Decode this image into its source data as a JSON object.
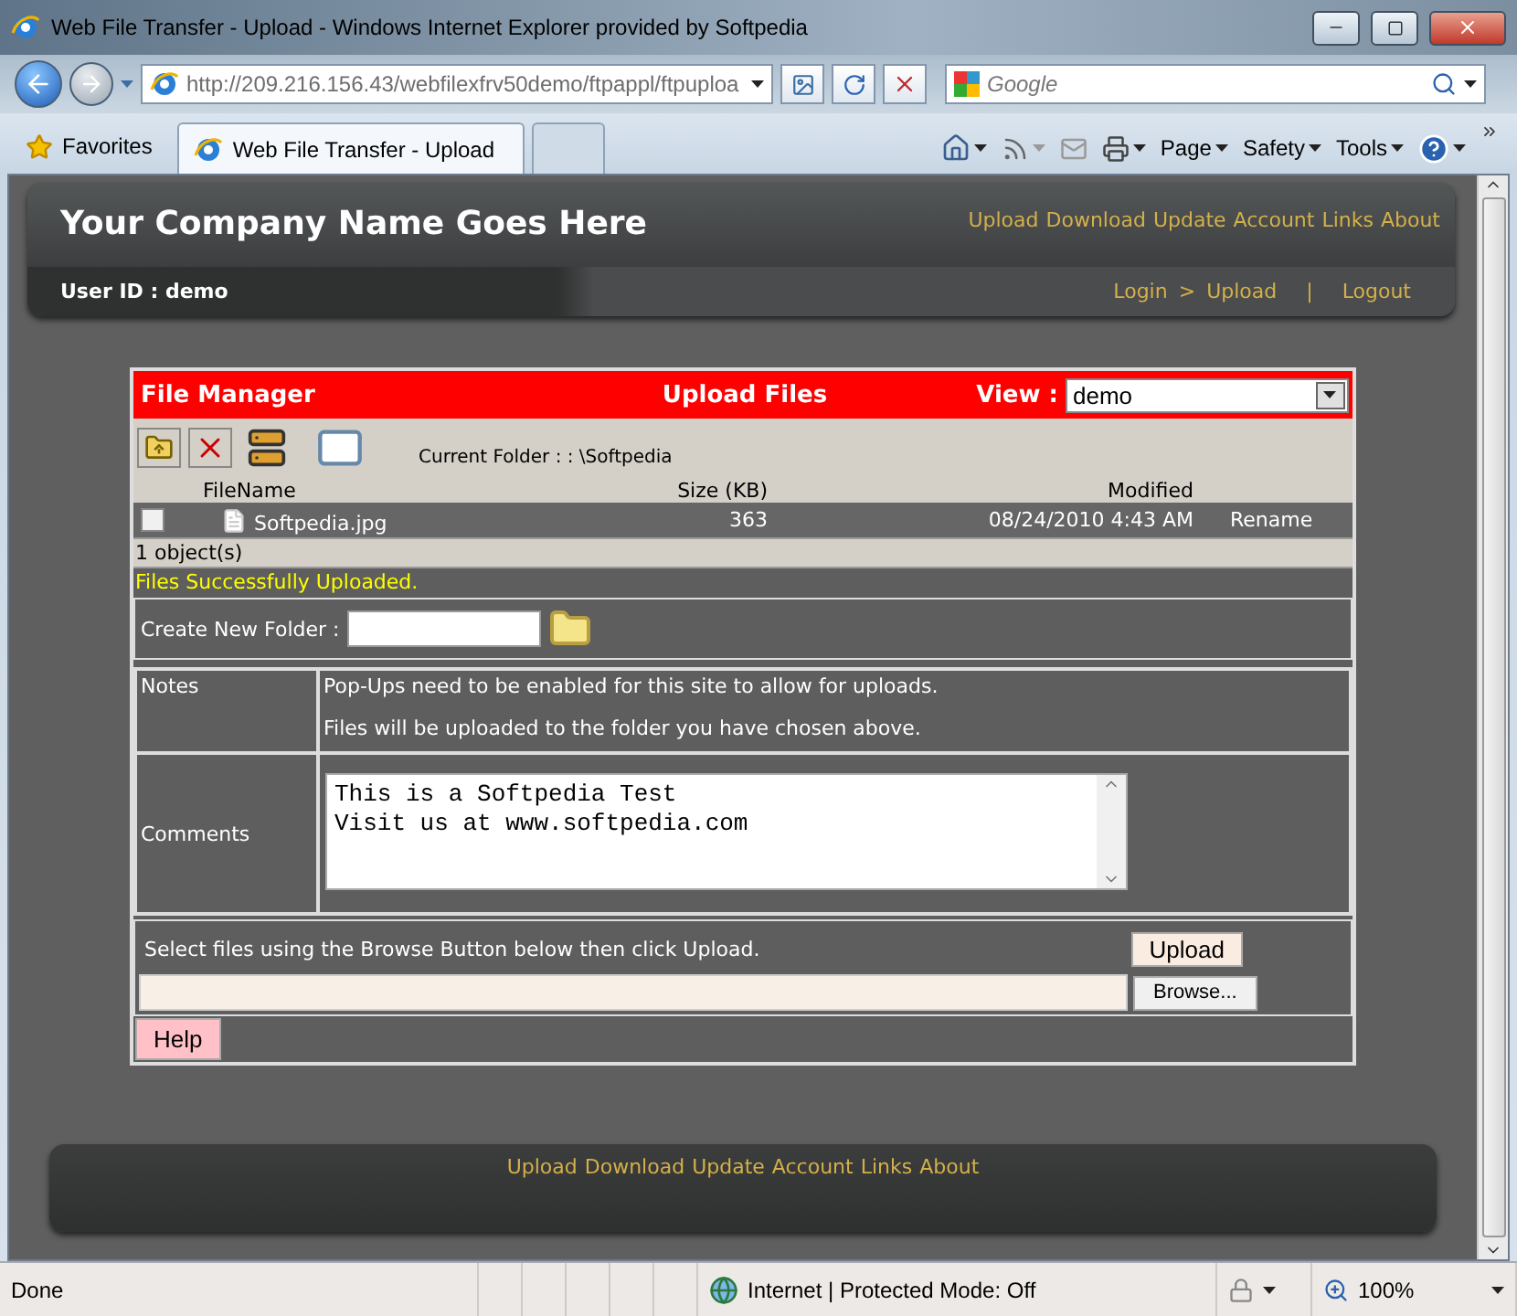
{
  "window": {
    "title": "Web File Transfer - Upload - Windows Internet Explorer provided by Softpedia"
  },
  "address_bar": {
    "url": "http://209.216.156.43/webfilexfrv50demo/ftpappl/ftpuploa"
  },
  "search": {
    "placeholder": "Google"
  },
  "favorites": {
    "label": "Favorites"
  },
  "tabs": [
    {
      "label": "Web File Transfer - Upload",
      "selected": true
    }
  ],
  "command_bar": [
    "Page",
    "Safety",
    "Tools"
  ],
  "header": {
    "company": "Your Company Name Goes Here",
    "nav_links": [
      "Upload",
      "Download",
      "Update",
      "Account",
      "Links",
      "About"
    ],
    "user_id": "User ID : demo",
    "breadcrumb": [
      "Login",
      ">",
      "Upload"
    ],
    "separator": "|",
    "logout": "Logout"
  },
  "file_manager": {
    "title": "File Manager",
    "heading": "Upload Files",
    "view_label": "View :",
    "view_value": "demo",
    "current_folder": "Current Folder : : \\Softpedia",
    "columns": [
      "FileName",
      "Size (KB)",
      "Modified"
    ],
    "rows": [
      {
        "name": "Softpedia.jpg",
        "size": "363",
        "modified": "08/24/2010 4:43 AM",
        "action": "Rename",
        "checked": false
      }
    ],
    "count": "1 object(s)",
    "message": "Files Successfully Uploaded.",
    "create_folder_label": "Create New Folder :",
    "notes_label": "Notes",
    "notes": [
      "Pop-Ups need to be enabled for this site to allow for uploads.",
      "Files will be uploaded to the folder you have chosen above."
    ],
    "comments_label": "Comments",
    "comments": "This is a Softpedia Test\nVisit us at www.softpedia.com",
    "instructions": "Select files using the Browse Button below then click Upload.",
    "upload_button": "Upload",
    "browse_button": "Browse...",
    "help_button": "Help"
  },
  "footer": {
    "links": [
      "Upload",
      "Download",
      "Update",
      "Account",
      "Links",
      "About"
    ]
  },
  "status_bar": {
    "status": "Done",
    "zone": "Internet | Protected Mode: Off",
    "zoom": "100%"
  }
}
